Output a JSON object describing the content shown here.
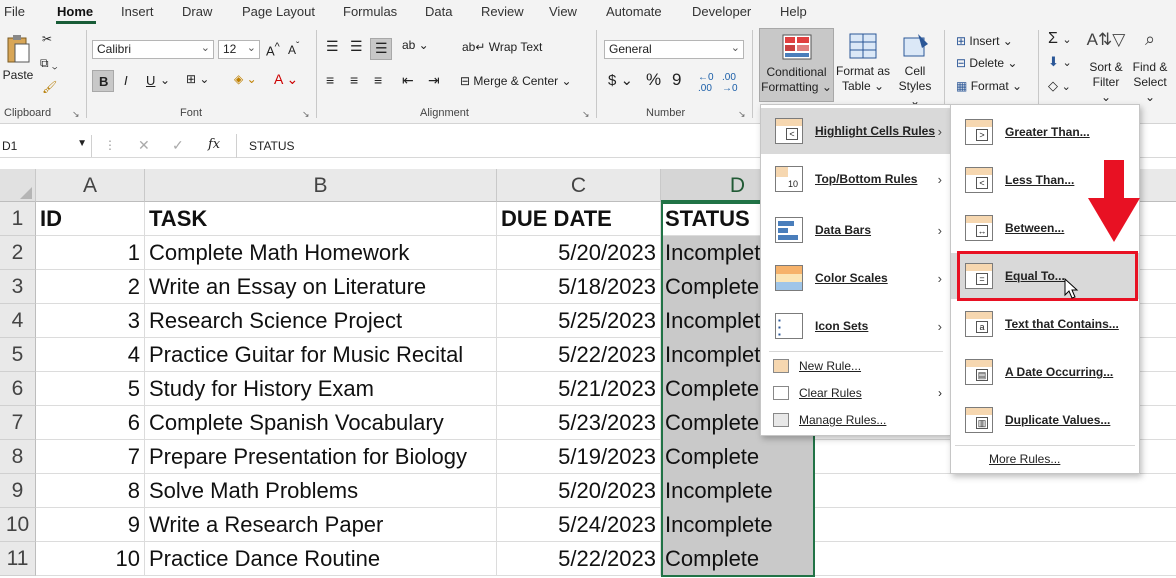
{
  "tabs": [
    "File",
    "Home",
    "Insert",
    "Draw",
    "Page Layout",
    "Formulas",
    "Data",
    "Review",
    "View",
    "Automate",
    "Developer",
    "Help"
  ],
  "clipboard": {
    "paste": "Paste",
    "label": "Clipboard"
  },
  "font": {
    "name": "Calibri",
    "size": "12",
    "label": "Font",
    "bold": "B",
    "italic": "I",
    "underline": "U"
  },
  "alignment": {
    "wrap": "Wrap Text",
    "merge": "Merge & Center",
    "label": "Alignment"
  },
  "number": {
    "format": "General",
    "label": "Number",
    "currency": "$",
    "percent": "%",
    "comma": "9"
  },
  "styles": {
    "cond_line1": "Conditional",
    "cond_line2": "Formatting",
    "fmt_line1": "Format as",
    "fmt_line2": "Table",
    "cell_line1": "Cell",
    "cell_line2": "Styles"
  },
  "cells": {
    "insert": "Insert",
    "delete": "Delete",
    "format": "Format"
  },
  "editing": {
    "sort_line1": "Sort &",
    "sort_line2": "Filter",
    "find_line1": "Find &",
    "find_line2": "Select"
  },
  "formula_bar": {
    "name_box": "D1",
    "fx": "fx",
    "value": "STATUS"
  },
  "columns": [
    "A",
    "B",
    "C",
    "D"
  ],
  "rows": [
    {
      "num": "1",
      "id": "ID",
      "task": "TASK",
      "due": "DUE DATE",
      "status": "STATUS"
    },
    {
      "num": "2",
      "id": "1",
      "task": "Complete Math Homework",
      "due": "5/20/2023",
      "status": "Incomplete"
    },
    {
      "num": "3",
      "id": "2",
      "task": "Write an Essay on Literature",
      "due": "5/18/2023",
      "status": "Complete"
    },
    {
      "num": "4",
      "id": "3",
      "task": "Research Science Project",
      "due": "5/25/2023",
      "status": "Incomplete"
    },
    {
      "num": "5",
      "id": "4",
      "task": "Practice Guitar for Music Recital",
      "due": "5/22/2023",
      "status": "Incomplete"
    },
    {
      "num": "6",
      "id": "5",
      "task": "Study for History Exam",
      "due": "5/21/2023",
      "status": "Complete"
    },
    {
      "num": "7",
      "id": "6",
      "task": "Complete Spanish Vocabulary",
      "due": "5/23/2023",
      "status": "Complete"
    },
    {
      "num": "8",
      "id": "7",
      "task": "Prepare Presentation for Biology",
      "due": "5/19/2023",
      "status": "Complete"
    },
    {
      "num": "9",
      "id": "8",
      "task": "Solve Math Problems",
      "due": "5/20/2023",
      "status": "Incomplete"
    },
    {
      "num": "10",
      "id": "9",
      "task": "Write a Research Paper",
      "due": "5/24/2023",
      "status": "Incomplete"
    },
    {
      "num": "11",
      "id": "10",
      "task": "Practice Dance Routine",
      "due": "5/22/2023",
      "status": "Complete"
    }
  ],
  "cf_menu": {
    "items": [
      "Highlight Cells Rules",
      "Top/Bottom Rules",
      "Data Bars",
      "Color Scales",
      "Icon Sets"
    ],
    "small": [
      "New Rule...",
      "Clear Rules",
      "Manage Rules..."
    ]
  },
  "sub_menu": {
    "items": [
      "Greater Than...",
      "Less Than...",
      "Between...",
      "Equal To...",
      "Text that Contains...",
      "A Date Occurring...",
      "Duplicate Values..."
    ],
    "more": "More Rules..."
  },
  "colors": {
    "excel_green": "#217346",
    "highlight_red": "#e81123",
    "selected_fill": "#c9c9c9"
  }
}
